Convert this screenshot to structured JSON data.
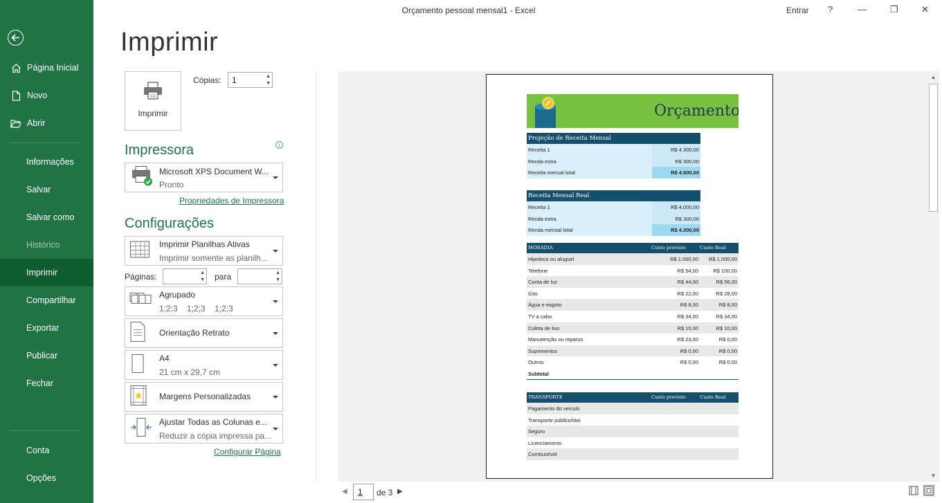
{
  "window": {
    "title": "Orçamento pessoal mensal1  -  Excel",
    "signin": "Entrar",
    "help": "?",
    "minimize": "—",
    "restore": "❐",
    "close": "✕"
  },
  "nav": {
    "top": [
      {
        "label": "Página Inicial",
        "icon": "home-icon"
      },
      {
        "label": "Novo",
        "icon": "new-document-icon"
      },
      {
        "label": "Abrir",
        "icon": "folder-open-icon"
      }
    ],
    "middle": [
      {
        "label": "Informações"
      },
      {
        "label": "Salvar"
      },
      {
        "label": "Salvar como"
      },
      {
        "label": "Histórico",
        "disabled": true
      },
      {
        "label": "Imprimir",
        "active": true
      },
      {
        "label": "Compartilhar"
      },
      {
        "label": "Exportar"
      },
      {
        "label": "Publicar"
      },
      {
        "label": "Fechar"
      }
    ],
    "bottom": [
      {
        "label": "Conta"
      },
      {
        "label": "Opções"
      }
    ]
  },
  "print": {
    "heading": "Imprimir",
    "button_label": "Imprimir",
    "copies_label": "Cópias:",
    "copies_value": "1",
    "printer_heading": "Impressora",
    "printer_name": "Microsoft XPS Document W...",
    "printer_status": "Pronto",
    "printer_properties_link": "Propriedades de Impressora",
    "settings_heading": "Configurações",
    "print_what": {
      "main": "Imprimir Planilhas Ativas",
      "sub": "Imprimir somente as planilh..."
    },
    "pages_label": "Páginas:",
    "to_label": "para",
    "collation": {
      "main": "Agrupado",
      "sub": "1;2;3    1;2;3    1;2;3"
    },
    "orientation": {
      "main": "Orientação Retrato"
    },
    "paper": {
      "main": "A4",
      "sub": "21 cm x 29,7 cm"
    },
    "margins": {
      "main": "Margens Personalizadas"
    },
    "scaling": {
      "main": "Ajustar Todas as Colunas e...",
      "sub": "Reduzir a cópia impressa pa..."
    },
    "page_setup_link": "Configurar Página"
  },
  "preview": {
    "banner_title": "Orçamento",
    "projected_income": {
      "title": "Projeção de Receita Mensal",
      "rows": [
        {
          "label": "Receita 1",
          "value": "R$ 4.300,00"
        },
        {
          "label": "Renda extra",
          "value": "R$ 300,00"
        },
        {
          "label": "Receita mensal total",
          "value": "R$ 4.600,00"
        }
      ]
    },
    "actual_income": {
      "title": "Receita Mensal Real",
      "rows": [
        {
          "label": "Receita 1",
          "value": "R$ 4.000,00"
        },
        {
          "label": "Renda extra",
          "value": "R$ 300,00"
        },
        {
          "label": "Renda mensal total",
          "value": "R$ 4.300,00"
        }
      ]
    },
    "housing": {
      "header": [
        "MORADIA",
        "Custo previsto",
        "Custo Real"
      ],
      "rows": [
        [
          "Hipoteca ou aluguel",
          "R$ 1.000,00",
          "R$ 1.000,00"
        ],
        [
          "Telefone",
          "R$ 54,00",
          "R$ 100,00"
        ],
        [
          "Conta de luz",
          "R$ 44,00",
          "R$ 56,00"
        ],
        [
          "Gás",
          "R$ 22,00",
          "R$ 28,00"
        ],
        [
          "Água e esgoto",
          "R$ 8,00",
          "R$ 8,00"
        ],
        [
          "TV a cabo",
          "R$ 34,00",
          "R$ 34,00"
        ],
        [
          "Coleta de lixo",
          "R$ 10,00",
          "R$ 10,00"
        ],
        [
          "Manutenção ou reparos",
          "R$ 23,00",
          "R$ 0,00"
        ],
        [
          "Suprimentos",
          "R$ 0,00",
          "R$ 0,00"
        ],
        [
          "Outros",
          "R$ 0,00",
          "R$ 0,00"
        ]
      ],
      "subtotal_label": "Subtotal"
    },
    "transport": {
      "header": [
        "TRANSPORTE",
        "Custo previsto",
        "Custo Real"
      ],
      "rows": [
        [
          "Pagamento do veículo",
          "",
          ""
        ],
        [
          "Transporte público/táxi",
          "",
          ""
        ],
        [
          "Seguro",
          "",
          ""
        ],
        [
          "Licenciamento",
          "",
          ""
        ],
        [
          "Combustível",
          "",
          ""
        ]
      ]
    }
  },
  "pager": {
    "current": "1",
    "of": "de 3"
  }
}
